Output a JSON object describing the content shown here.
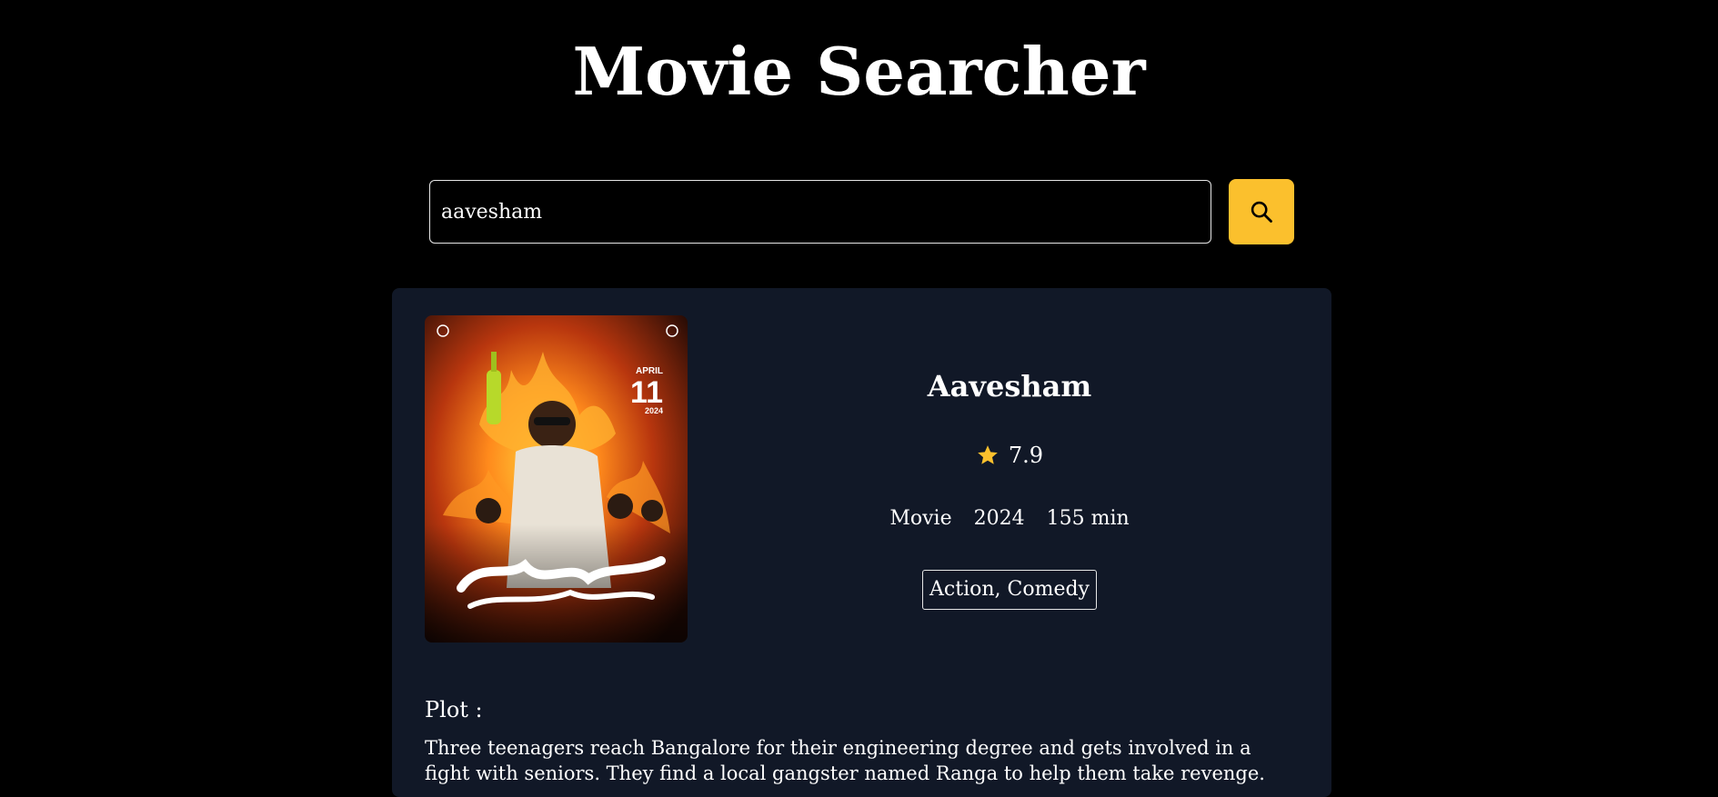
{
  "app": {
    "title": "Movie Searcher"
  },
  "search": {
    "value": "aavesham",
    "placeholder": "",
    "button_icon": "search-icon"
  },
  "movie": {
    "title": "Aavesham",
    "rating": "7.9",
    "type": "Movie",
    "year": "2024",
    "runtime": "155 min",
    "genres": "Action, Comedy",
    "plot_heading": "Plot :",
    "plot": "Three teenagers reach Bangalore for their engineering degree and gets involved in a fight with seniors. They find a local gangster named Ranga to help them take revenge.",
    "poster": {
      "release_month": "APRIL",
      "release_day": "11",
      "release_year": "2024"
    }
  },
  "colors": {
    "background": "#000000",
    "card": "#111827",
    "accent": "#fbc02d",
    "text": "#ffffff"
  }
}
